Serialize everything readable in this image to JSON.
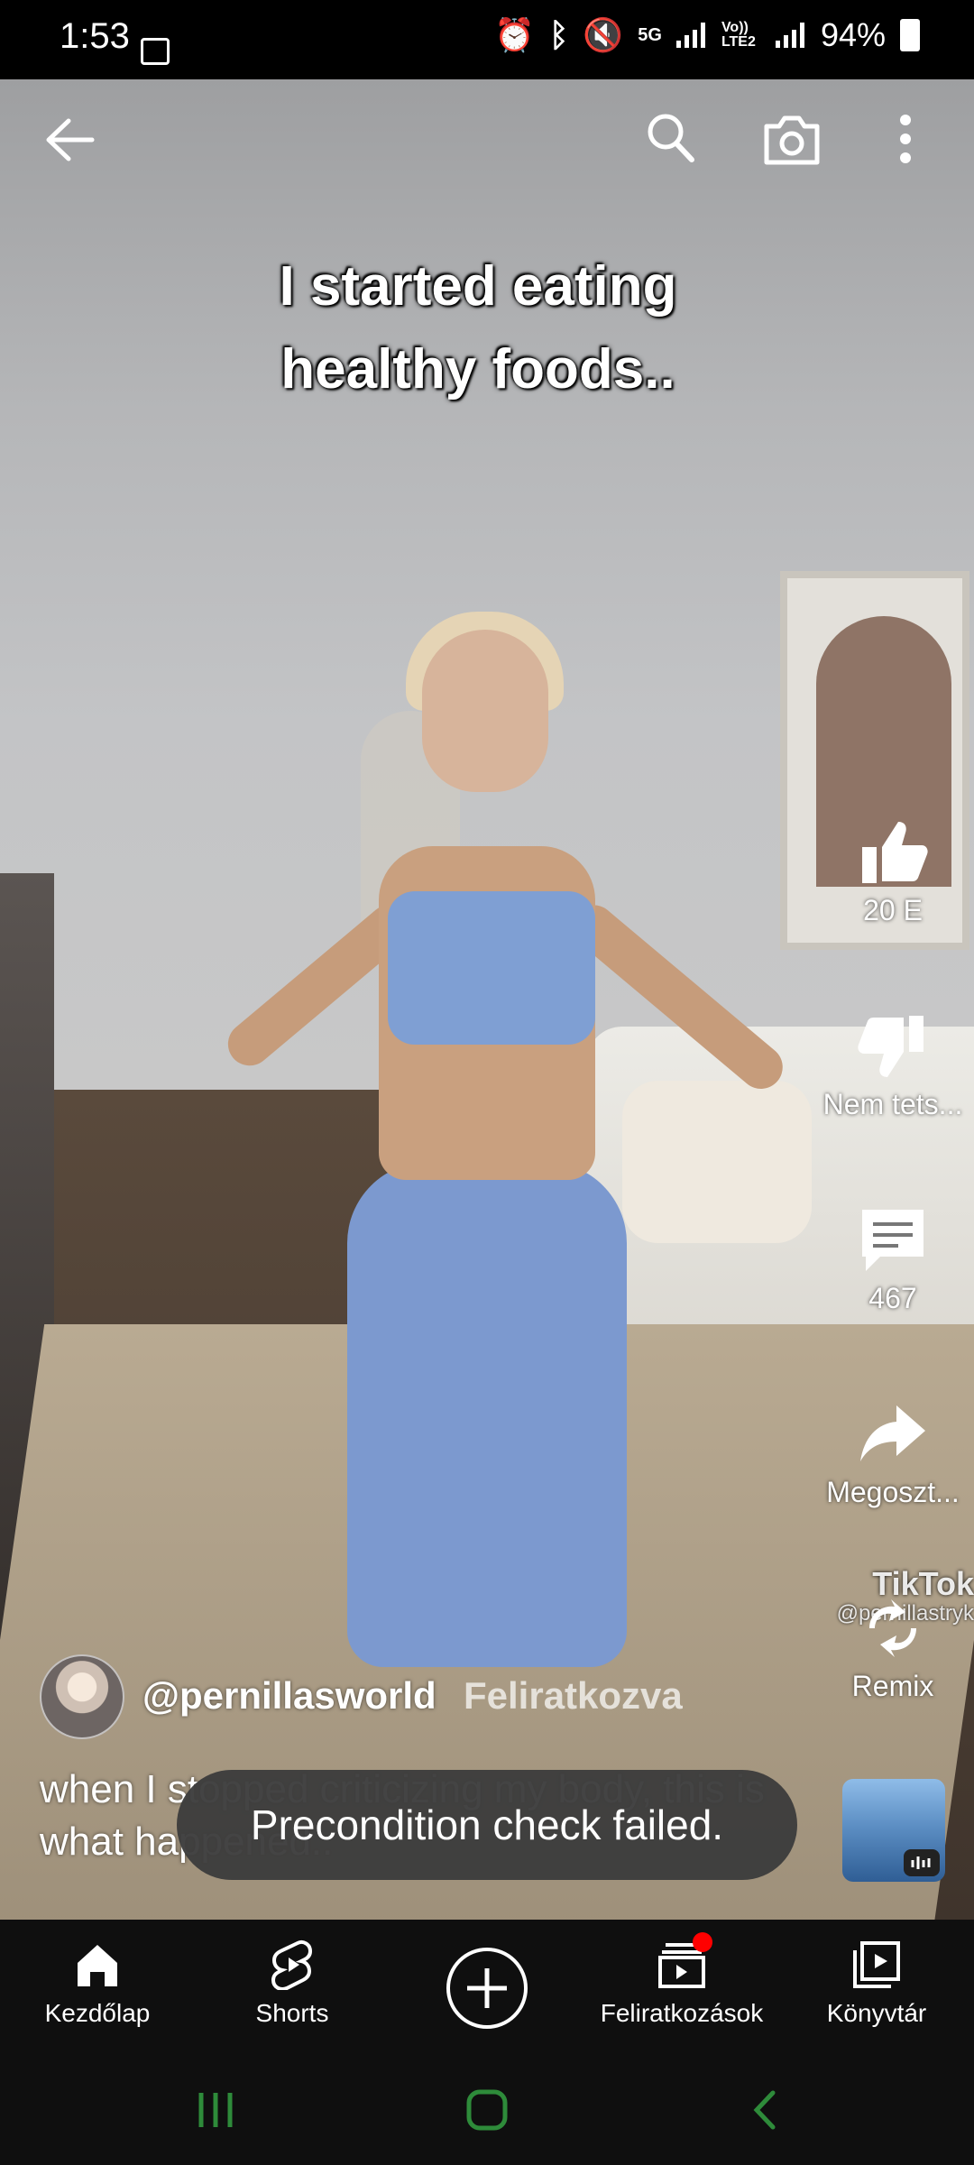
{
  "status_bar": {
    "time": "1:53",
    "network": "5G",
    "volte": "Vo)) LTE2",
    "battery": "94%"
  },
  "video": {
    "caption_line1": "I started eating",
    "caption_line2": "healthy foods..",
    "watermark": "TikTok",
    "watermark_user": "@pernillastryk"
  },
  "actions": {
    "like_count": "20 E",
    "dislike_label": "Nem tets...",
    "comments_count": "467",
    "share_label": "Megoszt...",
    "remix_label": "Remix"
  },
  "channel": {
    "handle": "@pernillasworld",
    "subscribe_state": "Feliratkozva"
  },
  "description": "when I stopped criticizing my body, this is what happened..",
  "toast": "Precondition check failed.",
  "nav": {
    "home": "Kezdőlap",
    "shorts": "Shorts",
    "subscriptions": "Feliratkozások",
    "library": "Könyvtár"
  },
  "colors": {
    "nav_bg": "#0f0f0f",
    "notification_dot": "#ff0000",
    "system_nav": "#2e8b3a"
  }
}
